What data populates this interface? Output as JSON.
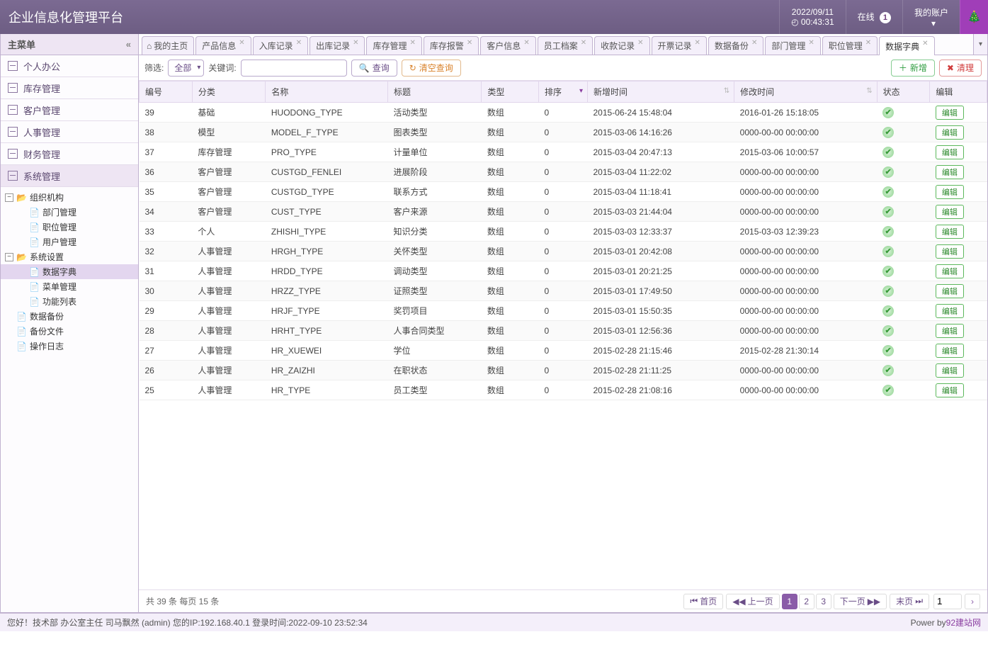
{
  "header": {
    "title": "企业信息化管理平台",
    "date": "2022/09/11",
    "clock_icon": "◴",
    "time": "00:43:31",
    "online_label": "在线",
    "online_count": "1",
    "account_label": "我的账户",
    "account_caret": "▾",
    "tree_icon": "🎄"
  },
  "sidebar": {
    "title": "主菜单",
    "collapse_icon": "«",
    "nav": [
      {
        "label": "个人办公"
      },
      {
        "label": "库存管理"
      },
      {
        "label": "客户管理"
      },
      {
        "label": "人事管理"
      },
      {
        "label": "财务管理"
      },
      {
        "label": "系统管理"
      }
    ],
    "tree": {
      "org": {
        "toggle": "−",
        "label": "组织机构",
        "children": [
          {
            "label": "部门管理"
          },
          {
            "label": "职位管理"
          },
          {
            "label": "用户管理"
          }
        ]
      },
      "sys": {
        "toggle": "−",
        "label": "系统设置",
        "children": [
          {
            "label": "数据字典"
          },
          {
            "label": "菜单管理"
          },
          {
            "label": "功能列表"
          }
        ]
      },
      "leaf1": {
        "label": "数据备份"
      },
      "leaf2": {
        "label": "备份文件"
      },
      "leaf3": {
        "label": "操作日志"
      }
    }
  },
  "tabs": {
    "home_icon": "⌂",
    "items": [
      "我的主页",
      "产品信息",
      "入库记录",
      "出库记录",
      "库存管理",
      "库存报警",
      "客户信息",
      "员工档案",
      "收款记录",
      "开票记录",
      "数据备份",
      "部门管理",
      "职位管理",
      "数据字典"
    ],
    "overflow_icon": "▾"
  },
  "toolbar": {
    "filter_label": "筛选:",
    "filter_value": "全部",
    "filter_caret": "▾",
    "keyword_label": "关键词:",
    "keyword_value": "",
    "search_icon": "🔍",
    "search_label": "查询",
    "clear_icon": "↻",
    "clear_label": "清空查询",
    "add_icon": "＋",
    "add_label": "新增",
    "clean_icon": "✖",
    "clean_label": "清理"
  },
  "grid": {
    "cols": [
      "编号",
      "分类",
      "名称",
      "标题",
      "类型",
      "排序",
      "新增时间",
      "修改时间",
      "状态",
      "编辑"
    ],
    "edit_label": "编辑",
    "check_icon": "✔",
    "sort_icon_dn": "▾",
    "sort_icon_ud": "⇅",
    "rows": [
      {
        "id": "39",
        "cat": "基础",
        "name": "HUODONG_TYPE",
        "title": "活动类型",
        "type": "数组",
        "sort": "0",
        "ct": "2015-06-24 15:48:04",
        "ut": "2016-01-26 15:18:05"
      },
      {
        "id": "38",
        "cat": "模型",
        "name": "MODEL_F_TYPE",
        "title": "图表类型",
        "type": "数组",
        "sort": "0",
        "ct": "2015-03-06 14:16:26",
        "ut": "0000-00-00 00:00:00"
      },
      {
        "id": "37",
        "cat": "库存管理",
        "name": "PRO_TYPE",
        "title": "计量单位",
        "type": "数组",
        "sort": "0",
        "ct": "2015-03-04 20:47:13",
        "ut": "2015-03-06 10:00:57"
      },
      {
        "id": "36",
        "cat": "客户管理",
        "name": "CUSTGD_FENLEI",
        "title": "进展阶段",
        "type": "数组",
        "sort": "0",
        "ct": "2015-03-04 11:22:02",
        "ut": "0000-00-00 00:00:00"
      },
      {
        "id": "35",
        "cat": "客户管理",
        "name": "CUSTGD_TYPE",
        "title": "联系方式",
        "type": "数组",
        "sort": "0",
        "ct": "2015-03-04 11:18:41",
        "ut": "0000-00-00 00:00:00"
      },
      {
        "id": "34",
        "cat": "客户管理",
        "name": "CUST_TYPE",
        "title": "客户来源",
        "type": "数组",
        "sort": "0",
        "ct": "2015-03-03 21:44:04",
        "ut": "0000-00-00 00:00:00"
      },
      {
        "id": "33",
        "cat": "个人",
        "name": "ZHISHI_TYPE",
        "title": "知识分类",
        "type": "数组",
        "sort": "0",
        "ct": "2015-03-03 12:33:37",
        "ut": "2015-03-03 12:39:23"
      },
      {
        "id": "32",
        "cat": "人事管理",
        "name": "HRGH_TYPE",
        "title": "关怀类型",
        "type": "数组",
        "sort": "0",
        "ct": "2015-03-01 20:42:08",
        "ut": "0000-00-00 00:00:00"
      },
      {
        "id": "31",
        "cat": "人事管理",
        "name": "HRDD_TYPE",
        "title": "调动类型",
        "type": "数组",
        "sort": "0",
        "ct": "2015-03-01 20:21:25",
        "ut": "0000-00-00 00:00:00"
      },
      {
        "id": "30",
        "cat": "人事管理",
        "name": "HRZZ_TYPE",
        "title": "证照类型",
        "type": "数组",
        "sort": "0",
        "ct": "2015-03-01 17:49:50",
        "ut": "0000-00-00 00:00:00"
      },
      {
        "id": "29",
        "cat": "人事管理",
        "name": "HRJF_TYPE",
        "title": "奖罚项目",
        "type": "数组",
        "sort": "0",
        "ct": "2015-03-01 15:50:35",
        "ut": "0000-00-00 00:00:00"
      },
      {
        "id": "28",
        "cat": "人事管理",
        "name": "HRHT_TYPE",
        "title": "人事合同类型",
        "type": "数组",
        "sort": "0",
        "ct": "2015-03-01 12:56:36",
        "ut": "0000-00-00 00:00:00"
      },
      {
        "id": "27",
        "cat": "人事管理",
        "name": "HR_XUEWEI",
        "title": "学位",
        "type": "数组",
        "sort": "0",
        "ct": "2015-02-28 21:15:46",
        "ut": "2015-02-28 21:30:14"
      },
      {
        "id": "26",
        "cat": "人事管理",
        "name": "HR_ZAIZHI",
        "title": "在职状态",
        "type": "数组",
        "sort": "0",
        "ct": "2015-02-28 21:11:25",
        "ut": "0000-00-00 00:00:00"
      },
      {
        "id": "25",
        "cat": "人事管理",
        "name": "HR_TYPE",
        "title": "员工类型",
        "type": "数组",
        "sort": "0",
        "ct": "2015-02-28 21:08:16",
        "ut": "0000-00-00 00:00:00"
      }
    ]
  },
  "pager": {
    "summary": "共 39 条 每页 15 条",
    "first_icon": "⏮",
    "first": "首页",
    "prev_icon": "◀◀",
    "prev": "上一页",
    "pages": [
      "1",
      "2",
      "3"
    ],
    "next": "下一页",
    "next_icon": "▶▶",
    "last": "末页",
    "last_icon": "⏭",
    "goto_value": "1",
    "go_icon": "›"
  },
  "footer": {
    "greet": "您好！技术部 办公室主任 司马飘然 (admin) 您的IP:192.168.40.1 登录时间:2022-09-10 23:52:34",
    "power": "Power by ",
    "link": "92建站网"
  }
}
